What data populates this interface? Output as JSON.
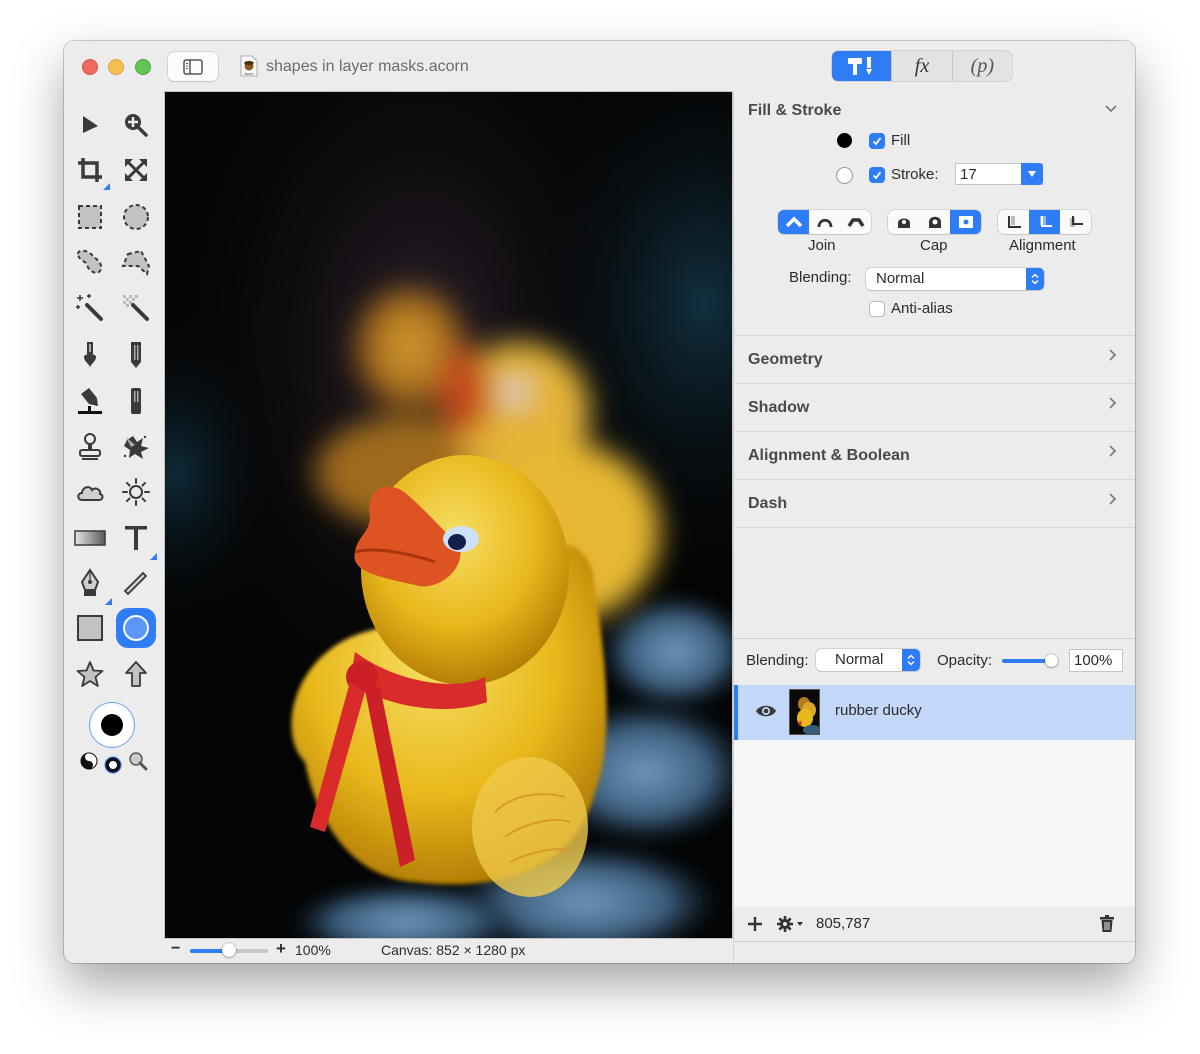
{
  "window": {
    "document_title": "shapes in layer masks.acorn",
    "doc_icon_label": "Acorn"
  },
  "top_segments": [
    {
      "name": "tools-inspector",
      "label": "",
      "icon": "hammer-brush-icon",
      "active": true
    },
    {
      "name": "filters",
      "label": "fx",
      "icon": "fx-icon",
      "active": false
    },
    {
      "name": "properties",
      "label": "(p)",
      "icon": "p-icon",
      "active": false
    }
  ],
  "tools": [
    {
      "name": "select-arrow",
      "icon": "arrow-pointer-icon"
    },
    {
      "name": "zoom",
      "icon": "zoom-in-icon"
    },
    {
      "name": "crop",
      "icon": "crop-icon",
      "has_submenu": true
    },
    {
      "name": "transform",
      "icon": "expand-arrows-icon"
    },
    {
      "name": "rect-select",
      "icon": "rect-marquee-icon"
    },
    {
      "name": "ellipse-select",
      "icon": "ellipse-marquee-icon"
    },
    {
      "name": "lasso",
      "icon": "lasso-icon"
    },
    {
      "name": "polygon-lasso",
      "icon": "polygon-lasso-icon"
    },
    {
      "name": "magic-wand",
      "icon": "magic-wand-icon"
    },
    {
      "name": "instant-alpha",
      "icon": "instant-alpha-wand-icon"
    },
    {
      "name": "brush",
      "icon": "brush-icon"
    },
    {
      "name": "pencil",
      "icon": "pencil-icon"
    },
    {
      "name": "paint-bucket",
      "icon": "paint-bucket-icon"
    },
    {
      "name": "eraser",
      "icon": "eraser-icon"
    },
    {
      "name": "clone-stamp",
      "icon": "stamp-icon"
    },
    {
      "name": "smudge",
      "icon": "splatter-icon"
    },
    {
      "name": "cloud-brush",
      "icon": "cloud-icon"
    },
    {
      "name": "dodge-burn",
      "icon": "sun-icon"
    },
    {
      "name": "gradient",
      "icon": "gradient-icon"
    },
    {
      "name": "text",
      "icon": "text-icon",
      "has_submenu": true
    },
    {
      "name": "bezier-pen",
      "icon": "pen-nib-icon",
      "has_submenu": true
    },
    {
      "name": "line",
      "icon": "line-icon"
    },
    {
      "name": "rectangle-shape",
      "icon": "square-shape-icon"
    },
    {
      "name": "oval-shape",
      "icon": "circle-shape-icon",
      "active": true
    },
    {
      "name": "star-shape",
      "icon": "star-icon"
    },
    {
      "name": "arrow-shape",
      "icon": "up-arrow-shape-icon"
    }
  ],
  "colors": {
    "accent": "#2e7cf6",
    "foreground": "#000000",
    "background": "#ffffff",
    "selected_layer_bg": "#c3d7f9"
  },
  "statusbar": {
    "zoom_minus": "−",
    "zoom_plus": "+",
    "zoom_level": "100%",
    "zoom_slider_value": 0.5,
    "canvas_info": "Canvas: 852 × 1280 px"
  },
  "inspector": {
    "fill_stroke": {
      "title": "Fill & Stroke",
      "fill_label": "Fill",
      "fill_checked": true,
      "fill_color": "#000000",
      "stroke_label": "Stroke:",
      "stroke_checked": true,
      "stroke_color": "#ffffff",
      "stroke_width": "17",
      "join_label": "Join",
      "join_options": [
        "miter",
        "round",
        "bevel"
      ],
      "join_selected": 0,
      "cap_label": "Cap",
      "cap_options": [
        "butt",
        "round",
        "square"
      ],
      "cap_selected": 2,
      "alignment_label": "Alignment",
      "alignment_options": [
        "outside",
        "center",
        "inside"
      ],
      "alignment_selected": 1,
      "blending_label": "Blending:",
      "blending_value": "Normal",
      "antialias_label": "Anti-alias",
      "antialias_checked": false
    },
    "sections": [
      {
        "title": "Geometry"
      },
      {
        "title": "Shadow"
      },
      {
        "title": "Alignment & Boolean"
      },
      {
        "title": "Dash"
      }
    ]
  },
  "layers": {
    "blending_label": "Blending:",
    "blending_value": "Normal",
    "opacity_label": "Opacity:",
    "opacity_value": "100%",
    "opacity_fraction": 1.0,
    "items": [
      {
        "name": "rubber ducky",
        "visible": true,
        "selected": true
      }
    ],
    "footer_coords": "805,787"
  }
}
